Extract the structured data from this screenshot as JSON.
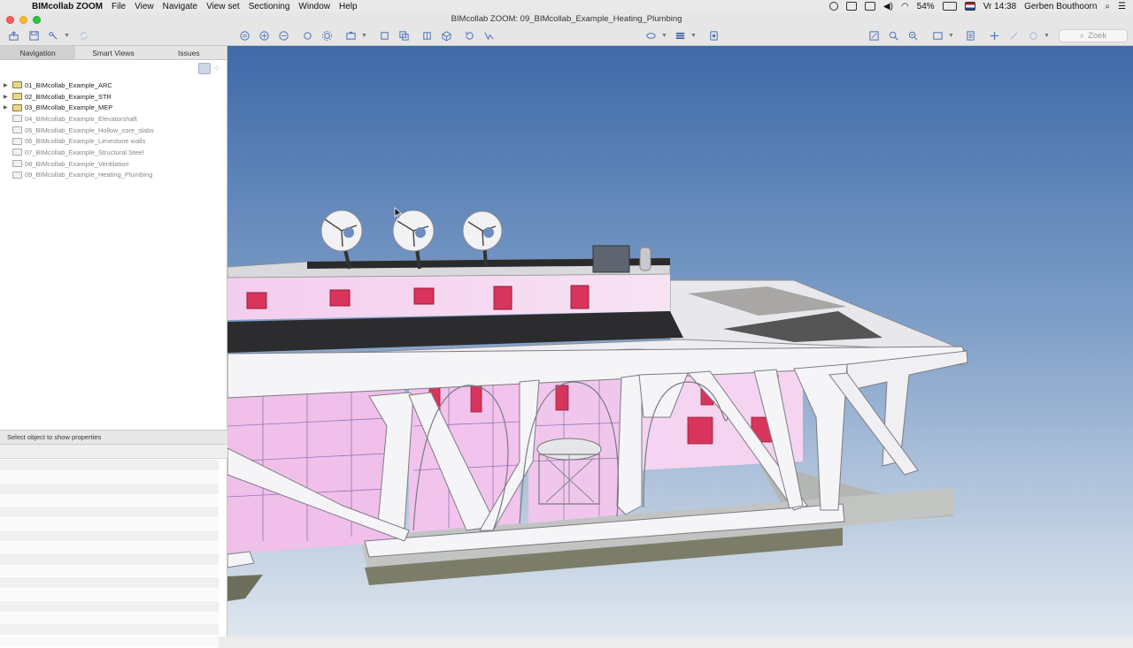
{
  "menubar": {
    "app_name": "BIMcollab ZOOM",
    "items": [
      "File",
      "View",
      "Navigate",
      "View set",
      "Sectioning",
      "Window",
      "Help"
    ],
    "battery": "54%",
    "clock": "Vr 14:38",
    "user": "Gerben Bouthoorn"
  },
  "window": {
    "title": "BIMcollab ZOOM: 09_BIMcollab_Example_Heating_Plumbing"
  },
  "toolbar": {
    "search_placeholder": "Zoek"
  },
  "sidebar": {
    "tabs": [
      {
        "label": "Navigation",
        "active": true
      },
      {
        "label": "Smart Views",
        "active": false
      },
      {
        "label": "Issues",
        "active": false
      }
    ],
    "models": [
      {
        "name": "01_BIMcollab_Example_ARC",
        "loaded": true
      },
      {
        "name": "02_BIMcollab_Example_STR",
        "loaded": true
      },
      {
        "name": "03_BIMcollab_Example_MEP",
        "loaded": true
      },
      {
        "name": "04_BIMcollab_Example_Elevatorshaft",
        "loaded": false
      },
      {
        "name": "05_BIMcollab_Example_Hollow_core_slabs",
        "loaded": false
      },
      {
        "name": "06_BIMcollab_Example_Limestone walls",
        "loaded": false
      },
      {
        "name": "07_BIMcollab_Example_Structural Steel",
        "loaded": false
      },
      {
        "name": "08_BIMcollab_Example_Ventilation",
        "loaded": false
      },
      {
        "name": "09_BIMcollab_Example_Heating_Plumbing",
        "loaded": false
      }
    ],
    "properties_hint": "Select object to show properties"
  },
  "colors": {
    "sky_top": "#3f6aa8",
    "sky_bottom": "#dfe6ee",
    "accent": "#5a7bbf",
    "wall_pink": "#f0c8ee",
    "window_red": "#d8345c"
  }
}
